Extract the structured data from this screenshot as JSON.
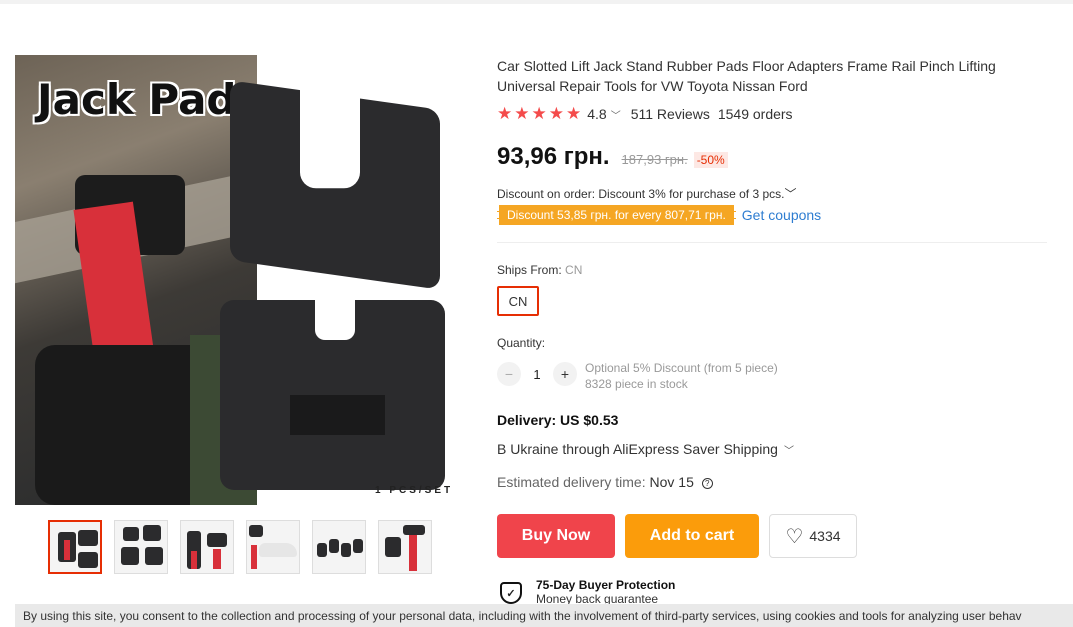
{
  "gallery": {
    "main_text": "Jack Pad",
    "pcs_text": "1 PCS/SET",
    "thumbnail_count": 6
  },
  "product": {
    "title": "Car Slotted Lift Jack Stand Rubber Pads Floor Adapters Frame Rail Pinch Lifting Universal Repair Tools for VW Toyota Nissan Ford",
    "rating": "4.8",
    "stars": 5,
    "reviews": "511 Reviews",
    "orders": "1549 orders"
  },
  "price": {
    "current": "93,96 грн.",
    "original": "187,93 грн.",
    "discount": "-50%"
  },
  "discounts": {
    "order_text": "Discount on order: Discount 3% for purchase of 3 pcs.",
    "coupon_badge": "Discount 53,85 грн. for every 807,71 грн.",
    "get_coupons": "Get coupons"
  },
  "shipping_from": {
    "label": "Ships From:",
    "value": "CN",
    "option": "CN"
  },
  "quantity": {
    "label": "Quantity:",
    "value": "1",
    "minus": "−",
    "plus": "+",
    "optional_discount": "Optional 5% Discount (from 5 piece)",
    "stock": "8328 piece in stock"
  },
  "delivery": {
    "cost": "Delivery: US $0.53",
    "method": "B Ukraine through AliExpress Saver Shipping",
    "estimated_label": "Estimated delivery time:",
    "estimated_date": "Nov 15"
  },
  "actions": {
    "buy_now": "Buy Now",
    "add_to_cart": "Add to cart",
    "wishlist_count": "4334"
  },
  "protection": {
    "title": "75-Day Buyer Protection",
    "subtitle": "Money back guarantee"
  },
  "cookie_notice": "By using this site, you consent to the collection and processing of your personal data, including with the involvement of third-party services, using cookies and tools for analyzing user behav",
  "colors": {
    "star": "#f44b4b",
    "buy_now": "#f0444b",
    "add_to_cart": "#fb9c0b",
    "coupon": "#f5a623",
    "link": "#2e7dd1",
    "accent": "#e62e04"
  }
}
